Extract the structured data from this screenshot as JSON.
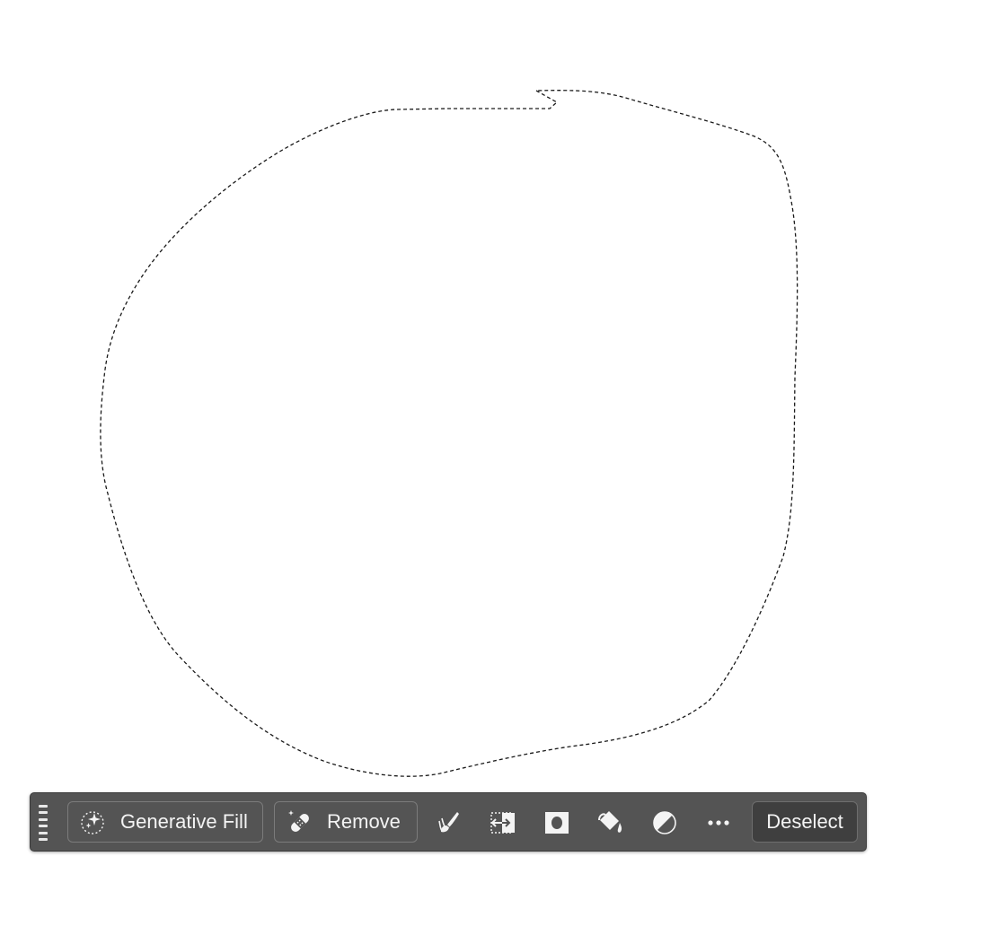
{
  "taskbar": {
    "generative_fill": {
      "label": "Generative Fill",
      "icon": "sparkle-selection-icon"
    },
    "remove": {
      "label": "Remove",
      "icon": "bandage-icon"
    },
    "tools": [
      {
        "name": "brush-icon"
      },
      {
        "name": "transform-selection-icon"
      },
      {
        "name": "mask-icon"
      },
      {
        "name": "paint-bucket-icon"
      },
      {
        "name": "adjustment-icon"
      },
      {
        "name": "more-icon"
      }
    ],
    "deselect": {
      "label": "Deselect"
    }
  },
  "colors": {
    "taskbar_bg": "#545454",
    "taskbar_border": "#3a3a3a",
    "button_border": "#7b7b7b",
    "deselect_bg": "#3f3f3f",
    "text": "#f4f4f4",
    "marquee": "#1a1a1a",
    "canvas": "#ffffff"
  }
}
